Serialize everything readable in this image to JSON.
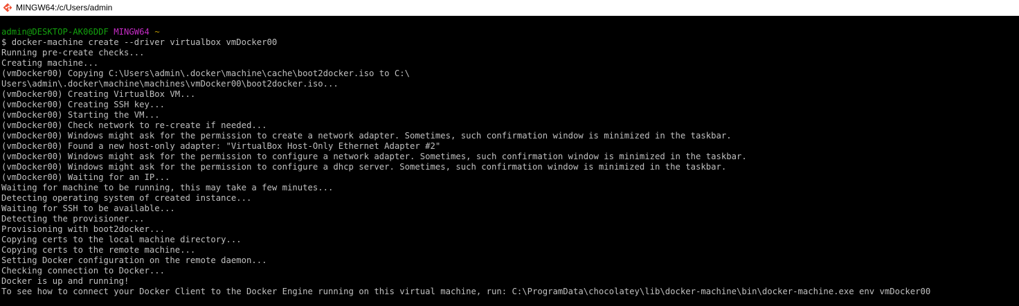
{
  "window": {
    "title": "MINGW64:/c/Users/admin",
    "app_icon": "git-bash-icon"
  },
  "terminal": {
    "background": "#000000",
    "foreground": "#c0c0c0",
    "prompt": {
      "user_host": "admin@DESKTOP-AK06DDF",
      "system": "MINGW64",
      "cwd": "~",
      "user_host_color": "#13a10e",
      "system_color": "#c62cc6",
      "cwd_color": "#c19c00"
    },
    "command_line": "$ docker-machine create --driver virtualbox vmDocker00",
    "output": [
      "Running pre-create checks...",
      "Creating machine...",
      "(vmDocker00) Copying C:\\Users\\admin\\.docker\\machine\\cache\\boot2docker.iso to C:\\",
      "Users\\admin\\.docker\\machine\\machines\\vmDocker00\\boot2docker.iso...",
      "(vmDocker00) Creating VirtualBox VM...",
      "(vmDocker00) Creating SSH key...",
      "(vmDocker00) Starting the VM...",
      "(vmDocker00) Check network to re-create if needed...",
      "(vmDocker00) Windows might ask for the permission to create a network adapter. Sometimes, such confirmation window is minimized in the taskbar.",
      "(vmDocker00) Found a new host-only adapter: \"VirtualBox Host-Only Ethernet Adapter #2\"",
      "(vmDocker00) Windows might ask for the permission to configure a network adapter. Sometimes, such confirmation window is minimized in the taskbar.",
      "(vmDocker00) Windows might ask for the permission to configure a dhcp server. Sometimes, such confirmation window is minimized in the taskbar.",
      "(vmDocker00) Waiting for an IP...",
      "Waiting for machine to be running, this may take a few minutes...",
      "Detecting operating system of created instance...",
      "Waiting for SSH to be available...",
      "Detecting the provisioner...",
      "Provisioning with boot2docker...",
      "Copying certs to the local machine directory...",
      "Copying certs to the remote machine...",
      "Setting Docker configuration on the remote daemon...",
      "Checking connection to Docker...",
      "Docker is up and running!",
      "To see how to connect your Docker Client to the Docker Engine running on this virtual machine, run: C:\\ProgramData\\chocolatey\\lib\\docker-machine\\bin\\docker-machine.exe env vmDocker00"
    ]
  }
}
